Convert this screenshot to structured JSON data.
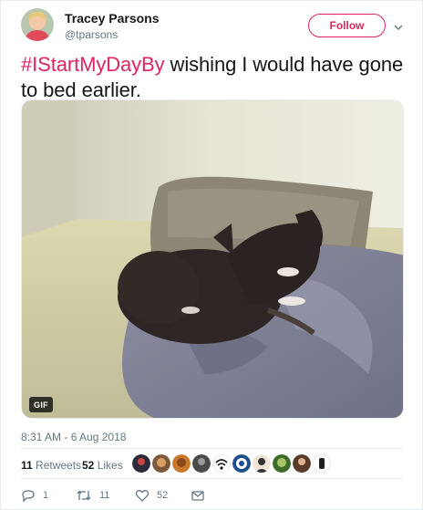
{
  "author": {
    "name": "Tracey Parsons",
    "handle": "@tparsons",
    "avatar_icon": "profile-photo"
  },
  "follow_button": {
    "label": "Follow",
    "color": "#e0245e"
  },
  "tweet": {
    "hashtag": "#IStartMyDayBy",
    "text": " wishing I would have gone to bed earlier."
  },
  "media": {
    "type": "gif",
    "badge": "GIF",
    "description_icon": "dog-on-bed-gif"
  },
  "timestamp": "8:31 AM - 6 Aug 2018",
  "stats": {
    "retweets_count": "11",
    "retweets_label": " Retweets",
    "likes_count": "52",
    "likes_label": " Likes",
    "likers": [
      "liker-1",
      "liker-2",
      "liker-3",
      "liker-4",
      "liker-5",
      "liker-6",
      "liker-7",
      "liker-8",
      "liker-9"
    ]
  },
  "actions": {
    "reply_count": "1",
    "retweet_count": "11",
    "like_count": "52",
    "reply_icon": "reply-icon",
    "retweet_icon": "retweet-icon",
    "like_icon": "heart-icon",
    "dm_icon": "envelope-icon"
  },
  "colors": {
    "accent": "#e0245e",
    "secondary_text": "#657786",
    "primary_text": "#14171a",
    "border": "#e6ecf0"
  }
}
